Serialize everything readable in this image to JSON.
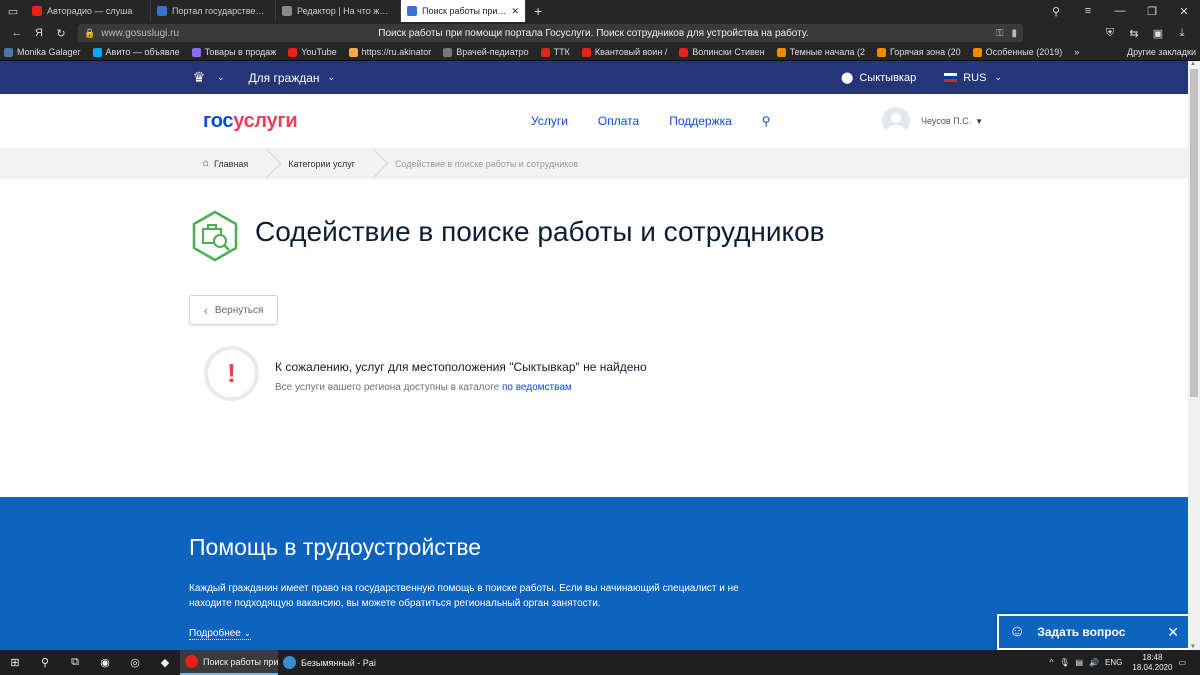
{
  "browser": {
    "tabs": [
      {
        "label": "Авторадио — слуша",
        "color": "#e62117",
        "active": false
      },
      {
        "label": "Портал государственных у",
        "color": "#3b6fd1",
        "active": false
      },
      {
        "label": "Редактор | На что жить и с",
        "color": "#888888",
        "active": false
      },
      {
        "label": "Поиск работы при пом",
        "color": "#3b6fd1",
        "active": true
      }
    ],
    "address_host": "www.gosuslugi.ru",
    "address_title": "Поиск работы при помощи портала Госуслуги. Поиск сотрудников для устройства на работу.",
    "bookmarks": [
      {
        "label": "Monika Galager",
        "color": "#4a76a8"
      },
      {
        "label": "Авито — объявле",
        "color": "#00aaff"
      },
      {
        "label": "Товары в продаж",
        "color": "#8e6cf0"
      },
      {
        "label": "YouTube",
        "color": "#e62117"
      },
      {
        "label": "https://ru.akinator",
        "color": "#f3a84c"
      },
      {
        "label": "Врачей-педиатро",
        "color": "#777777"
      },
      {
        "label": "ТТК",
        "color": "#e62117"
      },
      {
        "label": "Квантовый воин /",
        "color": "#e62117"
      },
      {
        "label": "Волински Стивен",
        "color": "#e62117"
      },
      {
        "label": "Темные начала (2",
        "color": "#f08c00"
      },
      {
        "label": "Горячая зона (20",
        "color": "#f08c00"
      },
      {
        "label": "Особенные (2019)",
        "color": "#f08c00"
      }
    ],
    "bookmarks_more": "Другие закладки"
  },
  "site": {
    "topbar": {
      "for_citizens": "Для граждан",
      "location": "Сыктывкар",
      "language": "RUS"
    },
    "logo_gos": "гос",
    "logo_usl": "услуги",
    "nav": [
      "Услуги",
      "Оплата",
      "Поддержка"
    ],
    "user_name": "Чеусов П.С.",
    "breadcrumbs": {
      "home": "Главная",
      "category": "Категории услуг",
      "current": "Содействие в поиске работы и сотрудников"
    },
    "page_title": "Содействие в поиске работы и сотрудников",
    "back_label": "Вернуться",
    "message_title": "К сожалению, услуг для местоположения \"Сыктывкар\" не найдено",
    "message_sub": "Все услуги вашего региона доступны в каталоге",
    "message_link": "по ведомствам",
    "promo": {
      "title": "Помощь в трудоустройстве",
      "text": "Каждый гражданин имеет право на государственную помощь в поиске работы. Если вы начинающий специалист и не находите подходящую вакансию, вы можете обратиться региональный орган занятости.",
      "more": "Подробнее"
    },
    "ask_label": "Задать вопрос",
    "colors": {
      "brand_blue": "#0d4cd3",
      "brand_red": "#ee3f58",
      "topbar": "#253678",
      "promo": "#0d63bd",
      "icon_green": "#4caf50"
    }
  },
  "taskbar": {
    "apps": [
      {
        "label": "Поиск работы при...",
        "color": "#e62117",
        "active": true
      },
      {
        "label": "Безымянный - Paint",
        "color": "#3b8fd1",
        "active": false
      }
    ],
    "lang": "ENG",
    "time": "18:48",
    "date": "18.04.2020"
  }
}
